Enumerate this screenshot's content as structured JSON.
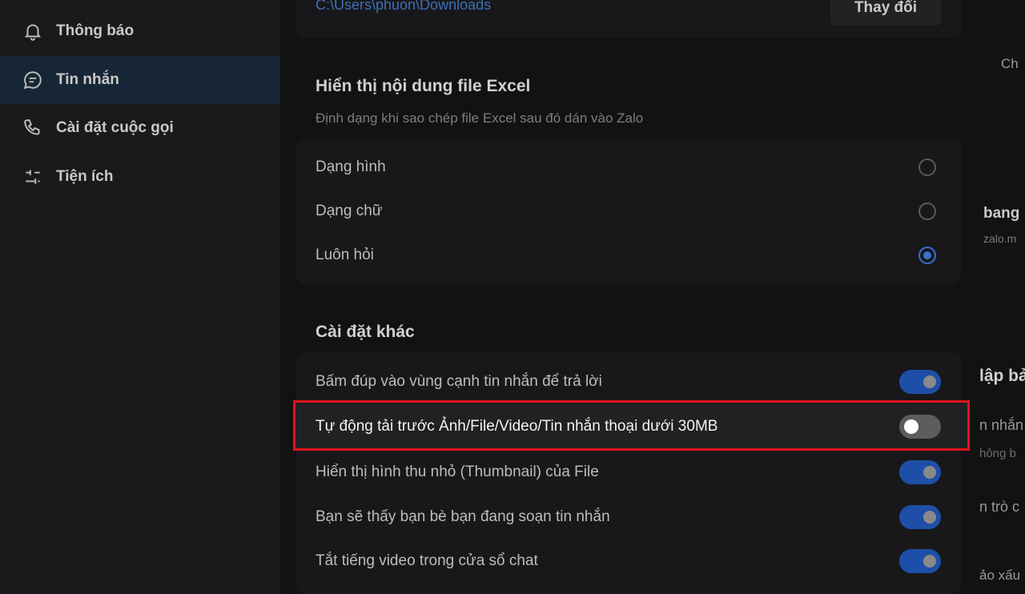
{
  "sidebar": {
    "items": [
      {
        "label": "Thông báo",
        "icon": "bell-icon"
      },
      {
        "label": "Tin nhắn",
        "icon": "chat-icon",
        "active": true
      },
      {
        "label": "Cài đặt cuộc gọi",
        "icon": "phone-icon"
      },
      {
        "label": "Tiện ích",
        "icon": "utilities-icon"
      }
    ]
  },
  "download": {
    "path": "C:\\Users\\phuon\\Downloads",
    "change_label": "Thay đổi"
  },
  "excel": {
    "title": "Hiển thị nội dung file Excel",
    "subtitle": "Định dạng khi sao chép file Excel sau đó dán vào Zalo",
    "options": [
      {
        "label": "Dạng hình",
        "selected": false
      },
      {
        "label": "Dạng chữ",
        "selected": false
      },
      {
        "label": "Luôn hỏi",
        "selected": true
      }
    ]
  },
  "other": {
    "title": "Cài đặt khác",
    "toggles": [
      {
        "label": "Bấm đúp vào vùng cạnh tin nhắn để trả lời",
        "on": true
      },
      {
        "label": "Tự động tải trước Ảnh/File/Video/Tin nhắn thoại dưới 30MB",
        "on": false
      },
      {
        "label": "Hiển thị hình thu nhỏ (Thumbnail) của File",
        "on": true
      },
      {
        "label": "Bạn sẽ thấy bạn bè bạn đang soạn tin nhắn",
        "on": true
      },
      {
        "label": "Tắt tiếng video trong cửa sổ chat",
        "on": true
      }
    ]
  },
  "right_panel": {
    "fragments": [
      "Ch",
      "bang",
      "zalo.m",
      "lập bả",
      "n nhắn",
      "hông b",
      "n trò c",
      "ảo xấu"
    ]
  },
  "colors": {
    "accent": "#1e4fa8",
    "highlight_border": "#e0151b",
    "link": "#3d6fb8"
  }
}
